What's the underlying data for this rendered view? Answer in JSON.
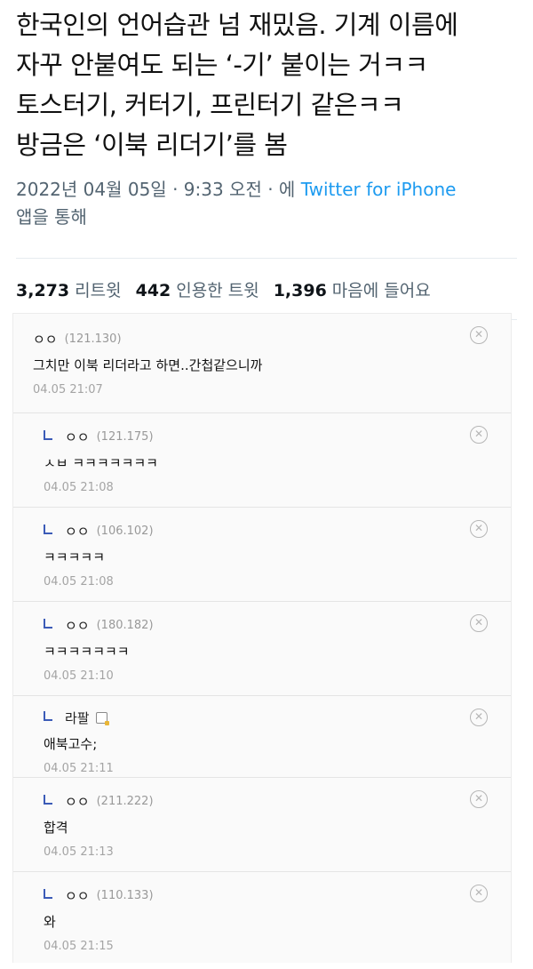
{
  "tweet": {
    "text_lines": [
      "한국인의 언어습관 넘 재밌음. 기계 이름에",
      "자꾸 안붙여도 되는 ‘-기’ 붙이는 거ㅋㅋ",
      "토스터기, 커터기, 프린터기 같은ㅋㅋ",
      "방금은 ‘이북 리더기’를 봄"
    ],
    "date": "2022년 04월 05일 · 9:33 오전 · 에",
    "via": "Twitter for iPhone",
    "via_suffix": "앱을 통해"
  },
  "stats": [
    {
      "count": "3,273",
      "label": "리트윗"
    },
    {
      "count": "442",
      "label": "인용한 트윗"
    },
    {
      "count": "1,396",
      "label": "마음에 들어요"
    }
  ],
  "comments": [
    {
      "author": "ㅇㅇ",
      "ip": "(121.130)",
      "body": "그치만 이북 리더라고 하면..간첩같으니까",
      "date": "04.05 21:07"
    },
    {
      "author": "ㅇㅇ",
      "ip": "(121.175)",
      "body": "ㅅㅂ ㅋㅋㅋㅋㅋㅋㅋ",
      "date": "04.05 21:08"
    },
    {
      "author": "ㅇㅇ",
      "ip": "(106.102)",
      "body": "ㅋㅋㅋㅋㅋ",
      "date": "04.05 21:08"
    },
    {
      "author": "ㅇㅇ",
      "ip": "(180.182)",
      "body": "ㅋㅋㅋㅋㅋㅋㅋ",
      "date": "04.05 21:10"
    },
    {
      "author": "라팔",
      "ip": "",
      "body": "애북고수;",
      "date": "04.05 21:11"
    },
    {
      "author": "ㅇㅇ",
      "ip": "(211.222)",
      "body": "합격",
      "date": "04.05 21:13"
    },
    {
      "author": "ㅇㅇ",
      "ip": "(110.133)",
      "body": "와",
      "date": "04.05 21:15"
    }
  ],
  "delete_icon": "circle-x-icon",
  "colors": {
    "link": "#1d9bf0",
    "reply_mark": "#3b5bb7"
  }
}
